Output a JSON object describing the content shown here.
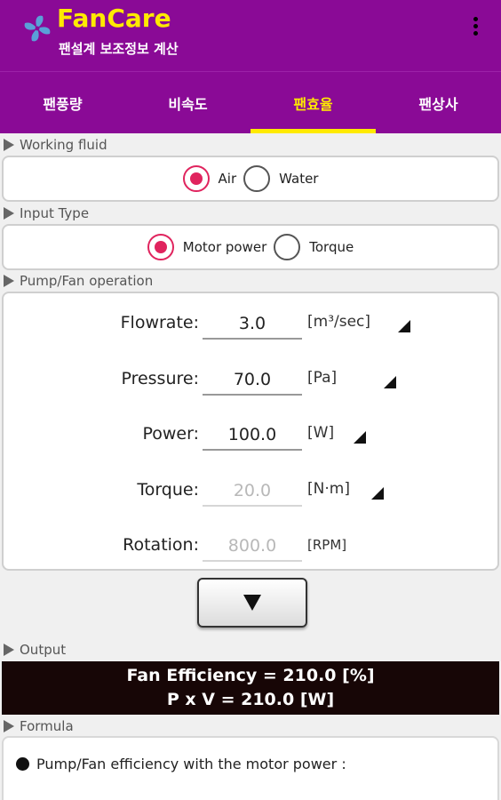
{
  "app": {
    "title": "FanCare",
    "subtitle": "팬설계 보조정보 계산"
  },
  "tabs": [
    {
      "label": "팬풍량",
      "active": false
    },
    {
      "label": "비속도",
      "active": false
    },
    {
      "label": "팬효율",
      "active": true
    },
    {
      "label": "팬상사",
      "active": false
    }
  ],
  "working_fluid": {
    "section": "Working fluid",
    "options": [
      {
        "label": "Air",
        "checked": true
      },
      {
        "label": "Water",
        "checked": false
      }
    ]
  },
  "input_type": {
    "section": "Input Type",
    "options": [
      {
        "label": "Motor power",
        "checked": true
      },
      {
        "label": "Torque",
        "checked": false
      }
    ]
  },
  "operation": {
    "section": "Pump/Fan operation",
    "fields": [
      {
        "label": "Flowrate:",
        "value": "3.0",
        "unit": "[m³/sec]",
        "enabled": true,
        "has_dropdown": true
      },
      {
        "label": "Pressure:",
        "value": "70.0",
        "unit": "[Pa]",
        "enabled": true,
        "has_dropdown": true
      },
      {
        "label": "Power:",
        "value": "100.0",
        "unit": "[W]",
        "enabled": true,
        "has_dropdown": true
      },
      {
        "label": "Torque:",
        "value": "20.0",
        "unit": "[N·m]",
        "enabled": false,
        "has_dropdown": true
      },
      {
        "label": "Rotation:",
        "value": "800.0",
        "unit": "[RPM]",
        "enabled": false,
        "has_dropdown": false
      }
    ]
  },
  "output": {
    "section": "Output",
    "line1": "Fan Efficiency =  210.0 [%]",
    "line2": "P x V =  210.0 [W]"
  },
  "formula": {
    "section": "Formula",
    "text": "Pump/Fan efficiency with the motor power :"
  },
  "colors": {
    "appbar": "#8a0a96",
    "accent": "#ffea00",
    "radio": "#e0245e",
    "output_bg": "#170606"
  }
}
